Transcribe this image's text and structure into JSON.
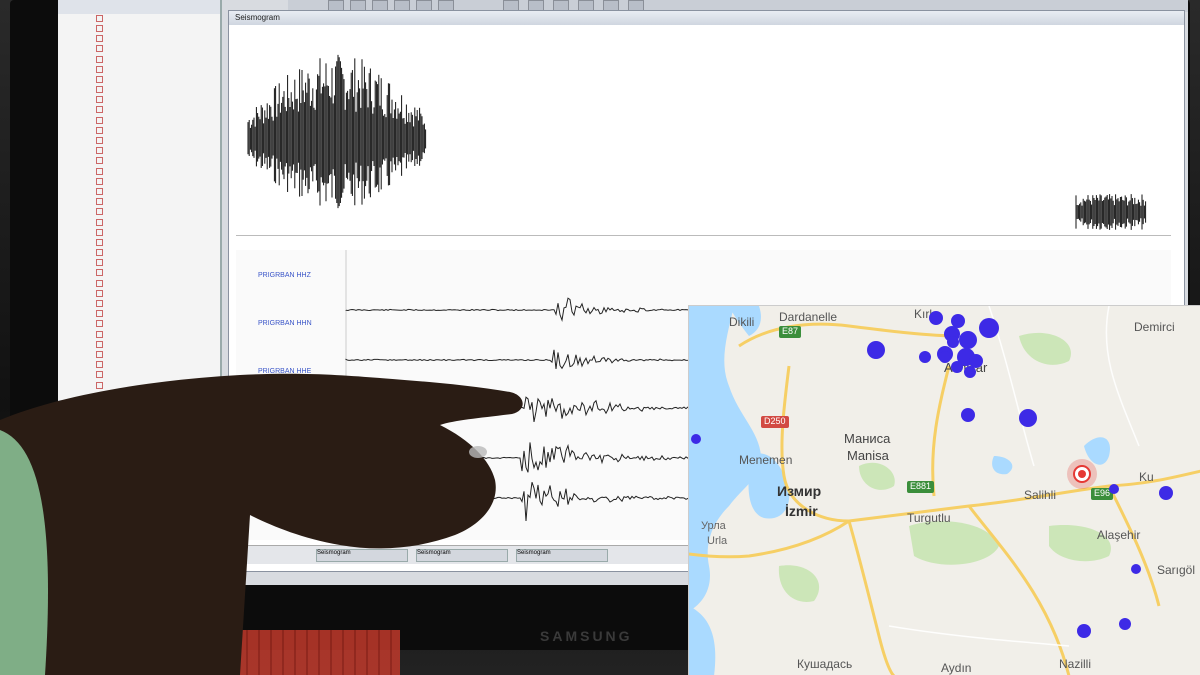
{
  "monitor": {
    "brand_text": "SAMSUNG"
  },
  "seismograph_app": {
    "window_title": "Seismogram",
    "trace_labels": [
      "PRIGRBAN HHZ",
      "PRIGRBAN HHN",
      "PRIGRBAN HHE"
    ],
    "status_tabs": [
      "Seismogram",
      "Seismogram",
      "Seismogram"
    ]
  },
  "map": {
    "places": [
      {
        "key": "dardanelle",
        "text": "Dardanelle"
      },
      {
        "key": "dikili",
        "text": "Dikili"
      },
      {
        "key": "kirkagac",
        "text": "Kırk"
      },
      {
        "key": "akhisar",
        "text": "Akhisar"
      },
      {
        "key": "demirci",
        "text": "Demirci"
      },
      {
        "key": "manisa_cyr",
        "text": "Маниса"
      },
      {
        "key": "manisa",
        "text": "Manisa"
      },
      {
        "key": "menemen",
        "text": "Menemen"
      },
      {
        "key": "izmir_cyr",
        "text": "Измир"
      },
      {
        "key": "izmir",
        "text": "İzmir"
      },
      {
        "key": "urla_cyr",
        "text": "Урла"
      },
      {
        "key": "urla",
        "text": "Urla"
      },
      {
        "key": "salihli",
        "text": "Salihli"
      },
      {
        "key": "turgutlu",
        "text": "Turgutlu"
      },
      {
        "key": "kula",
        "text": "Ku"
      },
      {
        "key": "alasehir",
        "text": "Alaşehir"
      },
      {
        "key": "sarigol",
        "text": "Sarıgöl"
      },
      {
        "key": "kusadasi",
        "text": "Кушадась"
      },
      {
        "key": "aydin",
        "text": "Aydın"
      },
      {
        "key": "nazilli",
        "text": "Nazilli"
      }
    ],
    "road_shields": [
      {
        "key": "e87",
        "text": "E87",
        "color": "green"
      },
      {
        "key": "d250",
        "text": "D250",
        "color": "red"
      },
      {
        "key": "e881",
        "text": "E881",
        "color": "green"
      },
      {
        "key": "e96",
        "text": "E96",
        "color": "green"
      }
    ],
    "colors": {
      "land": "#f1efe9",
      "water": "#aadaff",
      "green_area": "#cce6b8",
      "road": "#f6cf65",
      "quake_marker": "#3d2ae6",
      "epicenter_marker": "#e53935"
    }
  }
}
